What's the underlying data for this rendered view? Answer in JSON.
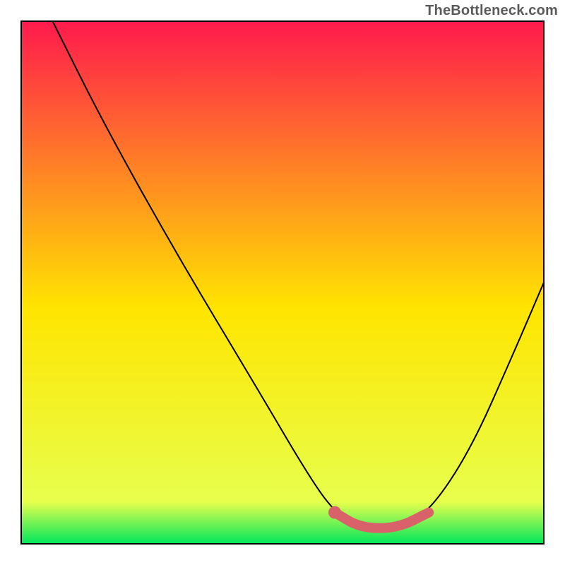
{
  "watermark": "TheBottleneck.com",
  "chart_data": {
    "type": "line",
    "title": "",
    "xlabel": "",
    "ylabel": "",
    "xlim": [
      0,
      100
    ],
    "ylim": [
      0,
      100
    ],
    "background_gradient": {
      "top": "#ff1a4d",
      "mid": "#ffe500",
      "bottom": "#00e65c"
    },
    "series": [
      {
        "name": "bottleneck-curve",
        "color": "#000000",
        "points": [
          {
            "x": 6,
            "y": 100
          },
          {
            "x": 16,
            "y": 80
          },
          {
            "x": 30,
            "y": 55
          },
          {
            "x": 45,
            "y": 30
          },
          {
            "x": 55,
            "y": 13
          },
          {
            "x": 60,
            "y": 6
          },
          {
            "x": 65,
            "y": 3
          },
          {
            "x": 72,
            "y": 3
          },
          {
            "x": 78,
            "y": 6
          },
          {
            "x": 86,
            "y": 18
          },
          {
            "x": 94,
            "y": 36
          },
          {
            "x": 100,
            "y": 50
          }
        ]
      },
      {
        "name": "highlight-region",
        "color": "#d9626a",
        "points": [
          {
            "x": 60,
            "y": 6
          },
          {
            "x": 65,
            "y": 3
          },
          {
            "x": 72,
            "y": 3
          },
          {
            "x": 78,
            "y": 6
          }
        ]
      }
    ],
    "markers": [
      {
        "name": "highlight-dot",
        "x": 60,
        "y": 6,
        "color": "#d9626a"
      }
    ]
  }
}
